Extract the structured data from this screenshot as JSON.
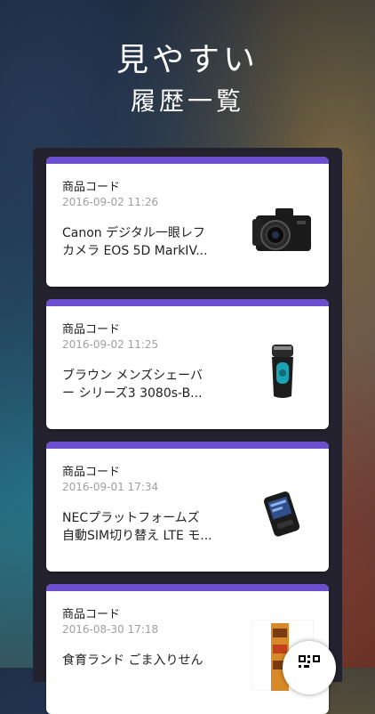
{
  "hero": {
    "line1": "見やすい",
    "line2": "履歴一覧"
  },
  "history": [
    {
      "type": "商品コード",
      "date": "2016-09-02 11:26",
      "name_line1": "Canon デジタル一眼レフ",
      "name_line2": "カメラ EOS 5D MarkIV...",
      "thumb_icon": "camera-icon"
    },
    {
      "type": "商品コード",
      "date": "2016-09-02 11:25",
      "name_line1": "ブラウン メンズシェーバ",
      "name_line2": "ー シリーズ3 3080s-B...",
      "thumb_icon": "shaver-icon"
    },
    {
      "type": "商品コード",
      "date": "2016-09-01 17:34",
      "name_line1": "NECプラットフォームズ",
      "name_line2": "自動SIM切り替え LTE モ...",
      "thumb_icon": "router-icon"
    },
    {
      "type": "商品コード",
      "date": "2016-08-30 17:18",
      "name_line1": "食育ランド ごま入りせん",
      "name_line2": "",
      "thumb_icon": "snack-package-icon"
    }
  ],
  "colors": {
    "accent": "#6b4fcf",
    "card": "#ffffff",
    "frame": "#23222e"
  },
  "fab": {
    "icon": "qr-code-icon"
  }
}
